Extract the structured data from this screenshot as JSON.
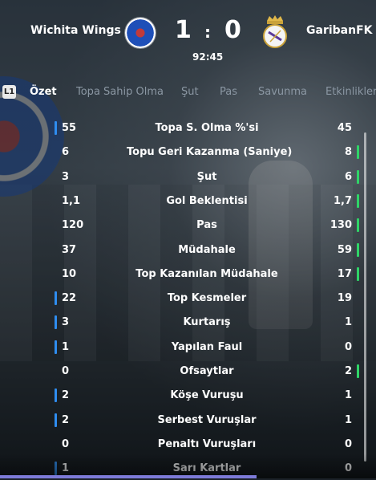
{
  "match": {
    "home_team": "Wichita Wings",
    "away_team": "GaribanFK",
    "home_score": "1",
    "separator": ":",
    "away_score": "0",
    "time": "92:45"
  },
  "tabs": {
    "button_hint": "L1",
    "items": [
      {
        "label": "Özet",
        "active": true
      },
      {
        "label": "Topa Sahip Olma",
        "active": false
      },
      {
        "label": "Şut",
        "active": false
      },
      {
        "label": "Pas",
        "active": false
      },
      {
        "label": "Savunma",
        "active": false
      },
      {
        "label": "Etkinlikler",
        "active": false
      }
    ]
  },
  "stats": [
    {
      "label": "Topa S. Olma %'si",
      "home": "55",
      "away": "45",
      "leader": "home"
    },
    {
      "label": "Topu Geri Kazanma (Saniye)",
      "home": "6",
      "away": "8",
      "leader": "away"
    },
    {
      "label": "Şut",
      "home": "3",
      "away": "6",
      "leader": "away"
    },
    {
      "label": "Gol Beklentisi",
      "home": "1,1",
      "away": "1,7",
      "leader": "away"
    },
    {
      "label": "Pas",
      "home": "120",
      "away": "130",
      "leader": "away"
    },
    {
      "label": "Müdahale",
      "home": "37",
      "away": "59",
      "leader": "away"
    },
    {
      "label": "Top Kazanılan Müdahale",
      "home": "10",
      "away": "17",
      "leader": "away"
    },
    {
      "label": "Top Kesmeler",
      "home": "22",
      "away": "19",
      "leader": "home"
    },
    {
      "label": "Kurtarış",
      "home": "3",
      "away": "1",
      "leader": "home"
    },
    {
      "label": "Yapılan Faul",
      "home": "1",
      "away": "0",
      "leader": "home"
    },
    {
      "label": "Ofsaytlar",
      "home": "0",
      "away": "2",
      "leader": "away"
    },
    {
      "label": "Köşe Vuruşu",
      "home": "2",
      "away": "1",
      "leader": "home"
    },
    {
      "label": "Serbest Vuruşlar",
      "home": "2",
      "away": "1",
      "leader": "home"
    },
    {
      "label": "Penaltı Vuruşları",
      "home": "0",
      "away": "0",
      "leader": "none"
    },
    {
      "label": "Sarı Kartlar",
      "home": "1",
      "away": "0",
      "leader": "home"
    }
  ],
  "colors": {
    "home_marker": "#2f8df0",
    "away_marker": "#2fd467",
    "tab_inactive": "#8b97a3"
  }
}
